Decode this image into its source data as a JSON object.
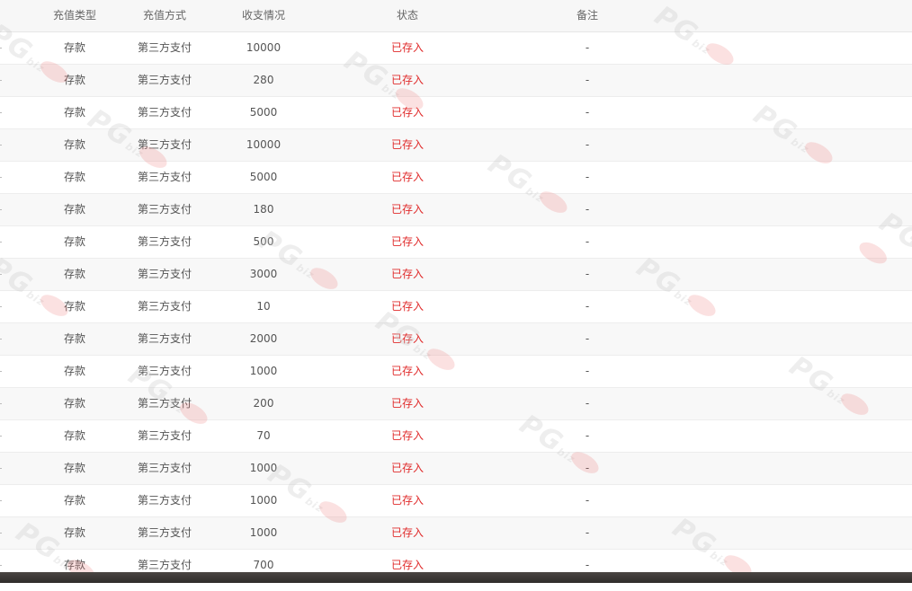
{
  "table": {
    "headers": {
      "type": "充值类型",
      "method": "充值方式",
      "amount": "收支情况",
      "status": "状态",
      "note": "备注"
    },
    "rows": [
      {
        "type": "存款",
        "method": "第三方支付",
        "amount": "10000",
        "status": "已存入",
        "note": "-"
      },
      {
        "type": "存款",
        "method": "第三方支付",
        "amount": "280",
        "status": "已存入",
        "note": "-"
      },
      {
        "type": "存款",
        "method": "第三方支付",
        "amount": "5000",
        "status": "已存入",
        "note": "-"
      },
      {
        "type": "存款",
        "method": "第三方支付",
        "amount": "10000",
        "status": "已存入",
        "note": "-"
      },
      {
        "type": "存款",
        "method": "第三方支付",
        "amount": "5000",
        "status": "已存入",
        "note": "-"
      },
      {
        "type": "存款",
        "method": "第三方支付",
        "amount": "180",
        "status": "已存入",
        "note": "-"
      },
      {
        "type": "存款",
        "method": "第三方支付",
        "amount": "500",
        "status": "已存入",
        "note": "-"
      },
      {
        "type": "存款",
        "method": "第三方支付",
        "amount": "3000",
        "status": "已存入",
        "note": "-"
      },
      {
        "type": "存款",
        "method": "第三方支付",
        "amount": "10",
        "status": "已存入",
        "note": "-"
      },
      {
        "type": "存款",
        "method": "第三方支付",
        "amount": "2000",
        "status": "已存入",
        "note": "-"
      },
      {
        "type": "存款",
        "method": "第三方支付",
        "amount": "1000",
        "status": "已存入",
        "note": "-"
      },
      {
        "type": "存款",
        "method": "第三方支付",
        "amount": "200",
        "status": "已存入",
        "note": "-"
      },
      {
        "type": "存款",
        "method": "第三方支付",
        "amount": "70",
        "status": "已存入",
        "note": "-"
      },
      {
        "type": "存款",
        "method": "第三方支付",
        "amount": "1000",
        "status": "已存入",
        "note": "-"
      },
      {
        "type": "存款",
        "method": "第三方支付",
        "amount": "1000",
        "status": "已存入",
        "note": "-"
      },
      {
        "type": "存款",
        "method": "第三方支付",
        "amount": "1000",
        "status": "已存入",
        "note": "-"
      },
      {
        "type": "存款",
        "method": "第三方支付",
        "amount": "700",
        "status": "已存入",
        "note": "-"
      }
    ]
  },
  "watermark": {
    "text": "PG",
    "sub": "biz"
  },
  "colors": {
    "status": "#e02b2b",
    "header_bg": "#f7f7f7",
    "stripe_bg": "#f8f8f8"
  }
}
